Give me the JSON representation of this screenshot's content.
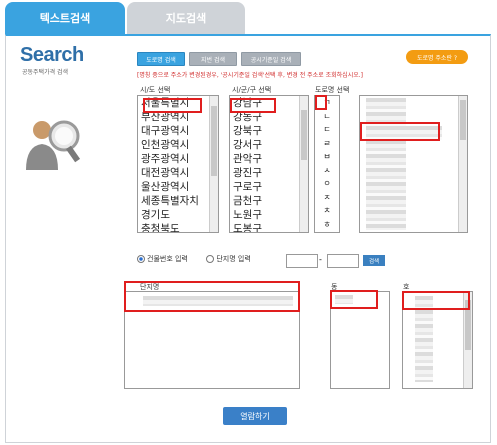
{
  "tabs": [
    {
      "label": "텍스트검색"
    },
    {
      "label": "지도검색"
    }
  ],
  "logo": {
    "title": "Search",
    "subtitle": "공동주택가격 검색"
  },
  "search_buttons": [
    {
      "label": "도로명 검색"
    },
    {
      "label": "지번 검색"
    },
    {
      "label": "공시기준일 검색"
    }
  ],
  "orange_button": {
    "label": "도로명 주소란 ?"
  },
  "notice": "[명칭 중으로 주소가 변경된경우, '공시기준일 검색'선택 후, 변경 전 주소로 조회하십시오.]",
  "columns": {
    "sido": "시/도 선택",
    "sigungu": "시/군/구 선택",
    "road": "도로명 선택"
  },
  "sido_list": [
    "서울특별시",
    "부산광역시",
    "대구광역시",
    "인천광역시",
    "광주광역시",
    "대전광역시",
    "울산광역시",
    "세종특별자치",
    "경기도",
    "충청북도"
  ],
  "sigungu_list": [
    "강남구",
    "강동구",
    "강북구",
    "강서구",
    "관악구",
    "광진구",
    "구로구",
    "금천구",
    "노원구",
    "도봉구"
  ],
  "jamo_list": [
    "ㄱ",
    "ㄴ",
    "ㄷ",
    "ㄹ",
    "ㅂ",
    "ㅅ",
    "ㅇ",
    "ㅈ",
    "ㅊ",
    "ㅎ"
  ],
  "radios": {
    "option1": "건물번호 입력",
    "option2": "단지명 입력",
    "separator": "-",
    "search": "검색"
  },
  "panels": {
    "complex": "단지명",
    "dong": "동",
    "ho": "호"
  },
  "submit": "열람하기",
  "colors": {
    "tab_active": "#3aa3e0",
    "tab_inactive": "#cfd3d8",
    "highlight": "#e01e1e",
    "orange": "#f39c12"
  }
}
